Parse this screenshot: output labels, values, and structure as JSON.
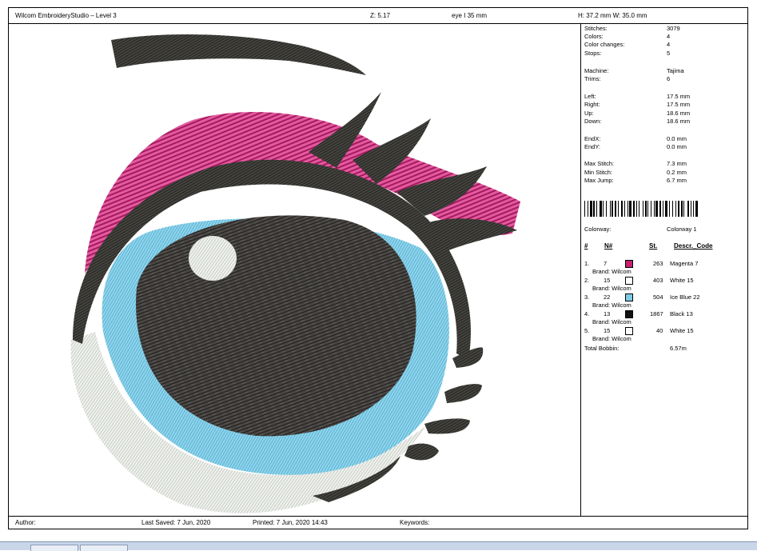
{
  "header": {
    "app_title": "Wilcom EmbroideryStudio – Level 3",
    "zoom": "Z: 5.17",
    "design_name": "eye I 35 mm",
    "dimensions": "H: 37.2 mm   W: 35.0 mm"
  },
  "stats": [
    {
      "key": "Stitches:",
      "value": "3079"
    },
    {
      "key": "Colors:",
      "value": "4"
    },
    {
      "key": "Color changes:",
      "value": "4"
    },
    {
      "key": "Stops:",
      "value": "5"
    },
    {
      "key": "Machine:",
      "value": "Tajima"
    },
    {
      "key": "Trims:",
      "value": "6"
    },
    {
      "key": "Left:",
      "value": "17.5 mm"
    },
    {
      "key": "Right:",
      "value": "17.5 mm"
    },
    {
      "key": "Up:",
      "value": "18.6 mm"
    },
    {
      "key": "Down:",
      "value": "18.6 mm"
    },
    {
      "key": "EndX:",
      "value": "0.0 mm"
    },
    {
      "key": "EndY:",
      "value": "0.0 mm"
    },
    {
      "key": "Max Stitch:",
      "value": "7.3 mm"
    },
    {
      "key": "Min Stitch:",
      "value": "0.2 mm"
    },
    {
      "key": "Max Jump:",
      "value": "6.7 mm"
    }
  ],
  "colorway": {
    "label": "Colorway:",
    "value": "Colorway 1"
  },
  "color_table": {
    "headers": {
      "num": "#",
      "n": "N#",
      "st": "St.",
      "descr": "Descr._Code"
    },
    "rows": [
      {
        "idx": "1.",
        "n": "7",
        "st": "263",
        "descr": "Magenta 7",
        "brand": "Brand: Wilcom",
        "color": "#c2226d"
      },
      {
        "idx": "2.",
        "n": "15",
        "st": "403",
        "descr": "White 15",
        "brand": "Brand: Wilcom",
        "color": "#ffffff"
      },
      {
        "idx": "3.",
        "n": "22",
        "st": "504",
        "descr": "Ice Blue 22",
        "brand": "Brand: Wilcom",
        "color": "#7fcbe3"
      },
      {
        "idx": "4.",
        "n": "13",
        "st": "1867",
        "descr": "Black 13",
        "brand": "Brand: Wilcom",
        "color": "#111111"
      },
      {
        "idx": "5.",
        "n": "15",
        "st": "40",
        "descr": "White 15",
        "brand": "Brand: Wilcom",
        "color": "#ffffff"
      }
    ],
    "total_label": "Total Bobbin:",
    "total_value": "6.57m"
  },
  "footer": {
    "author": "Author:",
    "last_saved": "Last Saved:  7 Jun, 2020",
    "printed": "Printed:  7 Jun, 2020 14:43",
    "keywords": "Keywords:"
  },
  "colors": {
    "magenta": "#c2226d",
    "ice_blue": "#7fcbe3",
    "pupil": "#3c3a38",
    "lash": "#3a3a36",
    "white_thread": "#e9ece8"
  }
}
